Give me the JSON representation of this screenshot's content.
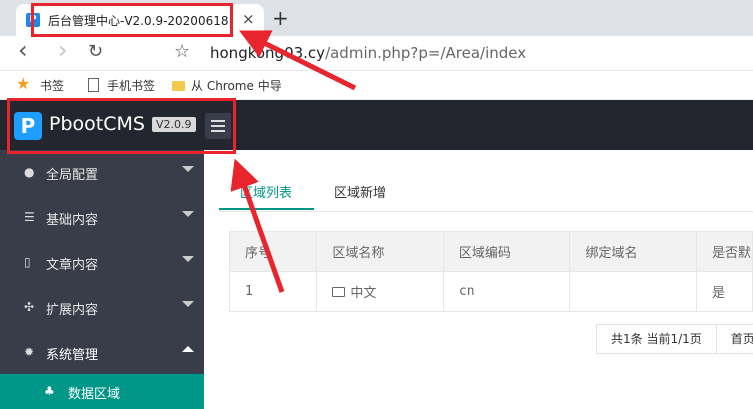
{
  "browser": {
    "tab_title": "后台管理中心-V2.0.9-20200618",
    "tab_close": "×",
    "new_tab": "+",
    "url_host": "hongkong03.cy",
    "url_path": "/admin.php?p=/Area/index",
    "nav_back": "‹",
    "nav_forward": "›",
    "reload": "↻",
    "bookmark_star": "☆"
  },
  "bookmarks": {
    "bookmarks_label": "书签",
    "mobile_label": "手机书签",
    "import_label": "从 Chrome 中导"
  },
  "header": {
    "brand": "PbootCMS",
    "version": "V2.0.9"
  },
  "sidebar": {
    "items": [
      {
        "label": "全局配置",
        "icon": "globe-icon"
      },
      {
        "label": "基础内容",
        "icon": "sliders-icon"
      },
      {
        "label": "文章内容",
        "icon": "file-icon"
      },
      {
        "label": "扩展内容",
        "icon": "expand-icon"
      },
      {
        "label": "系统管理",
        "icon": "gear-icon"
      }
    ],
    "sub_item": {
      "label": "数据区域",
      "icon": "sitemap-icon"
    }
  },
  "content": {
    "tabs": [
      "区域列表",
      "区域新增"
    ],
    "table": {
      "headers": [
        "序号",
        "区域名称",
        "区域编码",
        "绑定域名",
        "是否默"
      ],
      "rows": [
        [
          "1",
          "中文",
          "cn",
          "",
          "是"
        ]
      ]
    },
    "pager": {
      "info": "共1条 当前1/1页",
      "first": "首页"
    }
  },
  "colors": {
    "accent": "#009688",
    "header_bg": "#23262e",
    "sidebar_bg": "#393d49",
    "annotation": "#e8242c"
  }
}
